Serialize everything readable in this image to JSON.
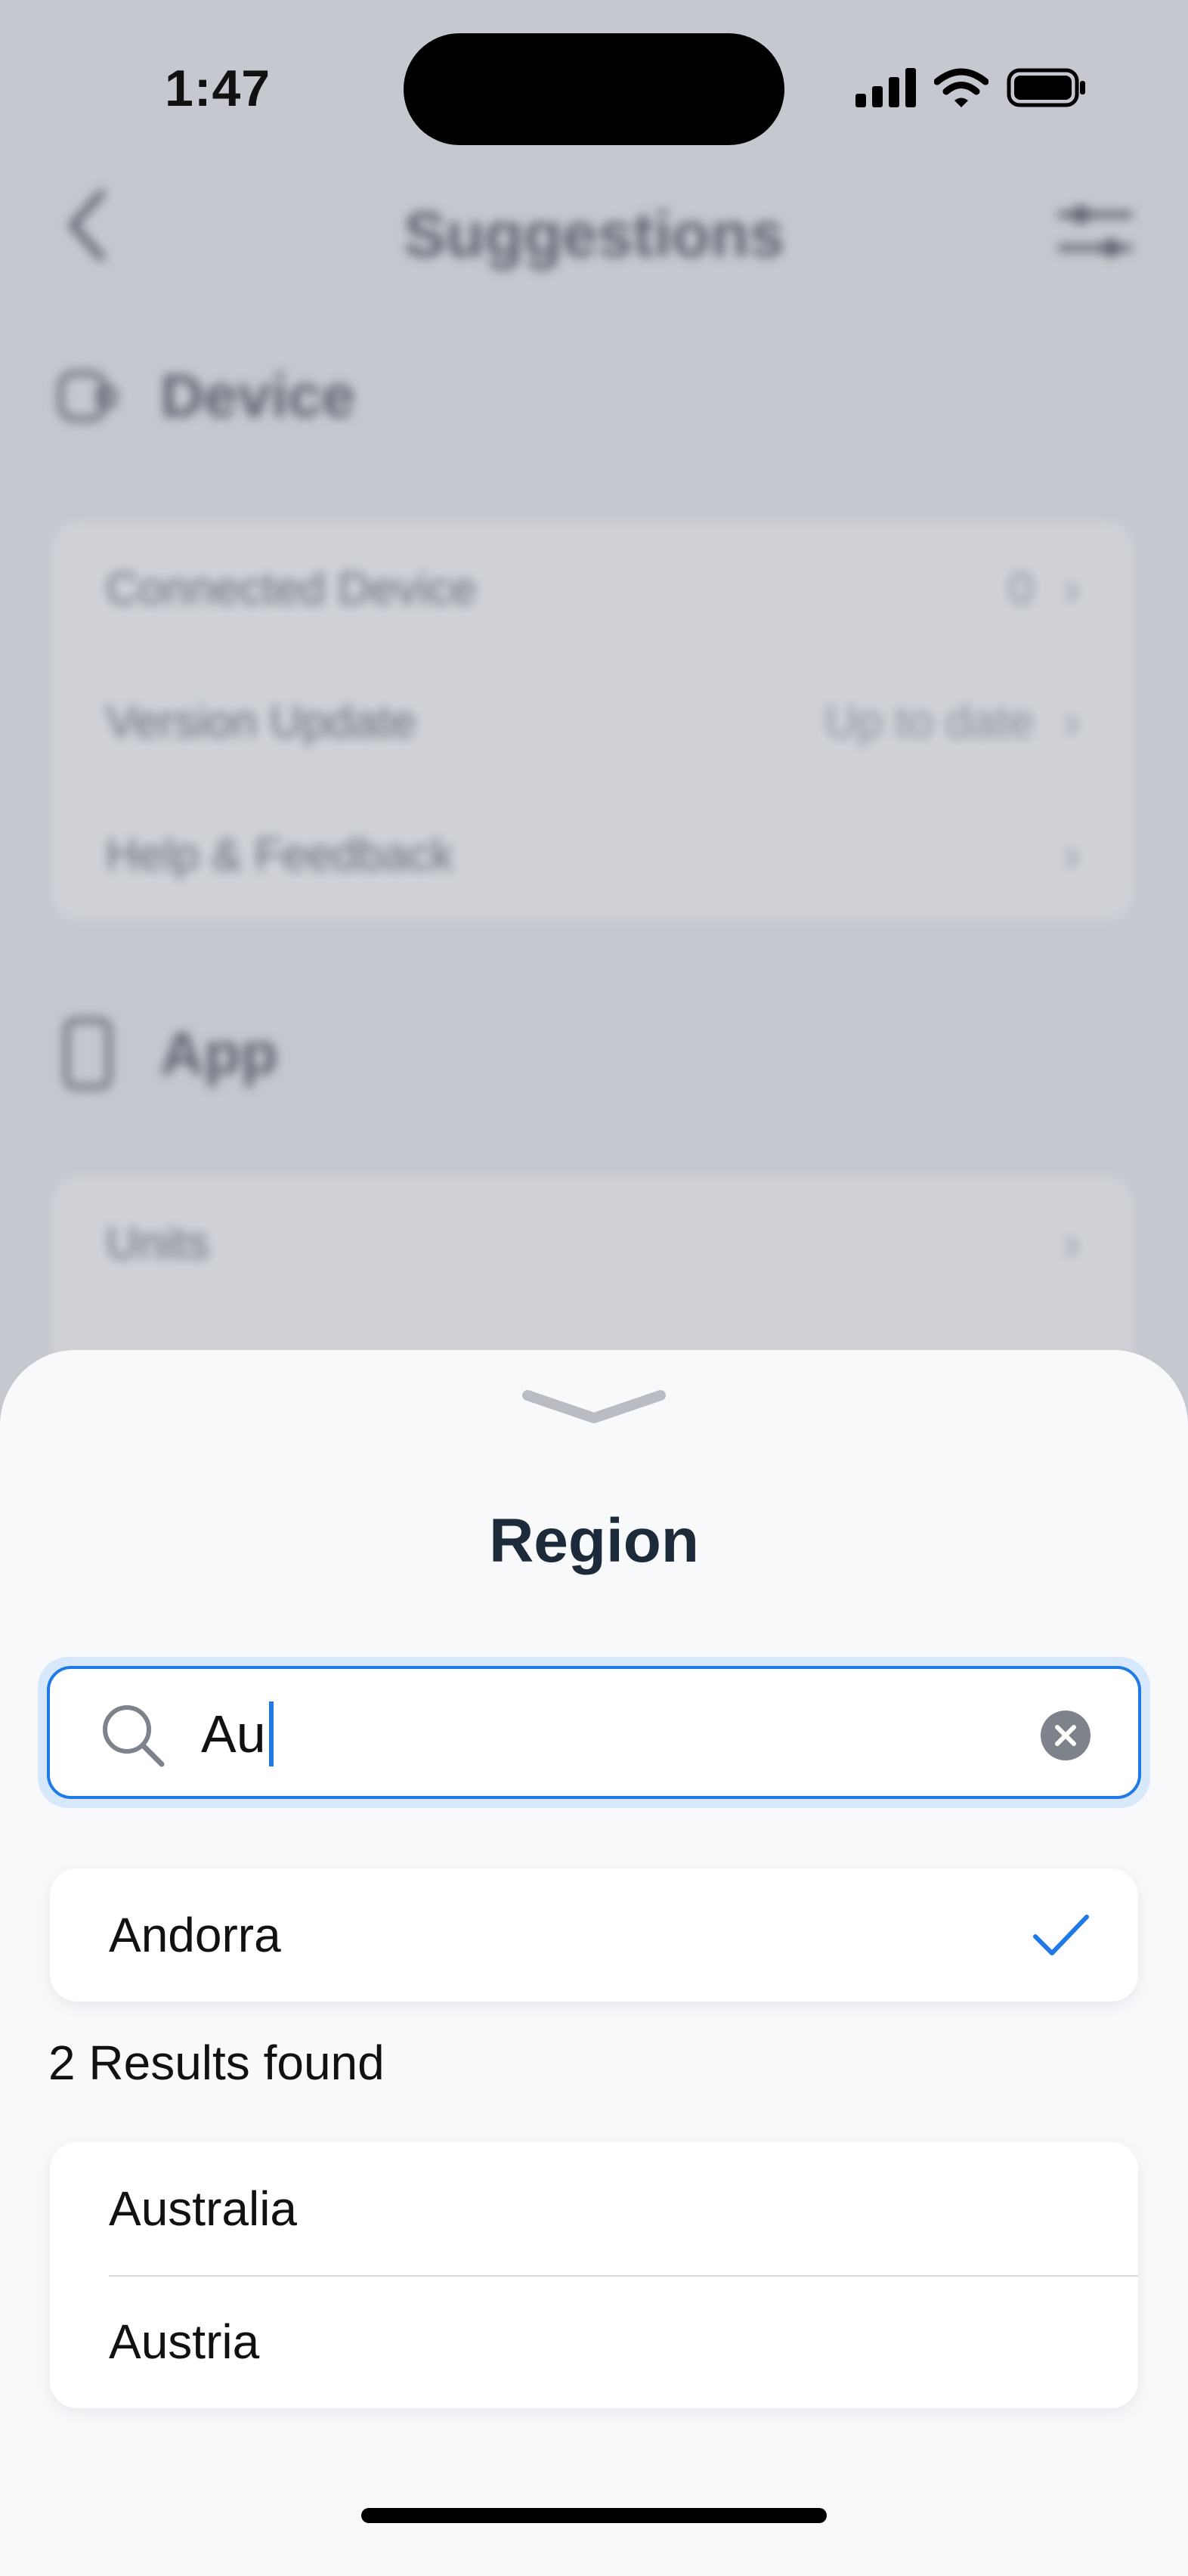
{
  "status_bar": {
    "time": "1:47"
  },
  "background": {
    "title": "Suggestions",
    "device_section": {
      "heading": "Device",
      "rows": [
        {
          "label": "Connected Device",
          "value": "0"
        },
        {
          "label": "Version Update",
          "value": "Up to date"
        },
        {
          "label": "Help & Feedback",
          "value": ""
        }
      ]
    },
    "app_section": {
      "heading": "App",
      "rows": [
        {
          "label": "Units",
          "value": ""
        }
      ]
    }
  },
  "sheet": {
    "title": "Region",
    "search": {
      "value": "Au",
      "placeholder": ""
    },
    "selected": {
      "label": "Andorra"
    },
    "results_label": "2 Results found",
    "results": [
      "Australia",
      "Austria"
    ]
  },
  "colors": {
    "accent": "#1f7ae8",
    "sheet_bg": "#f8f9fb",
    "overlay_bg": "#c6c8cf",
    "title_text": "#1d2a3a"
  }
}
